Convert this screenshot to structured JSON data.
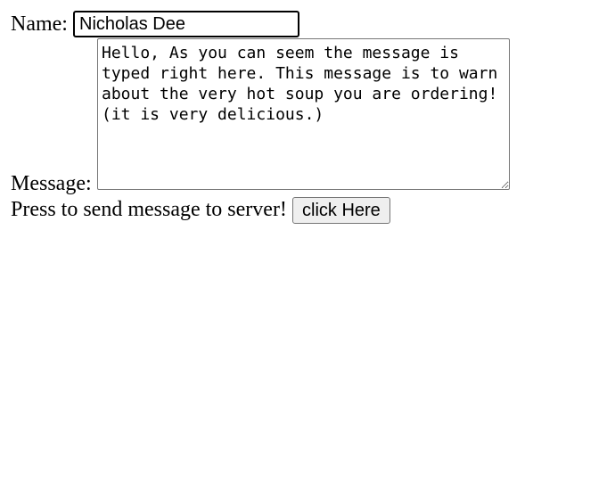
{
  "form": {
    "name_label": "Name:",
    "name_value": "Nicholas Dee",
    "message_label": "Message:",
    "message_value": "Hello, As you can seem the message is\ntyped right here. This message is to warn\nabout the very hot soup you are ordering!\n(it is very delicious.)",
    "send_label": "Press to send message to server!",
    "button_label": "click Here"
  }
}
